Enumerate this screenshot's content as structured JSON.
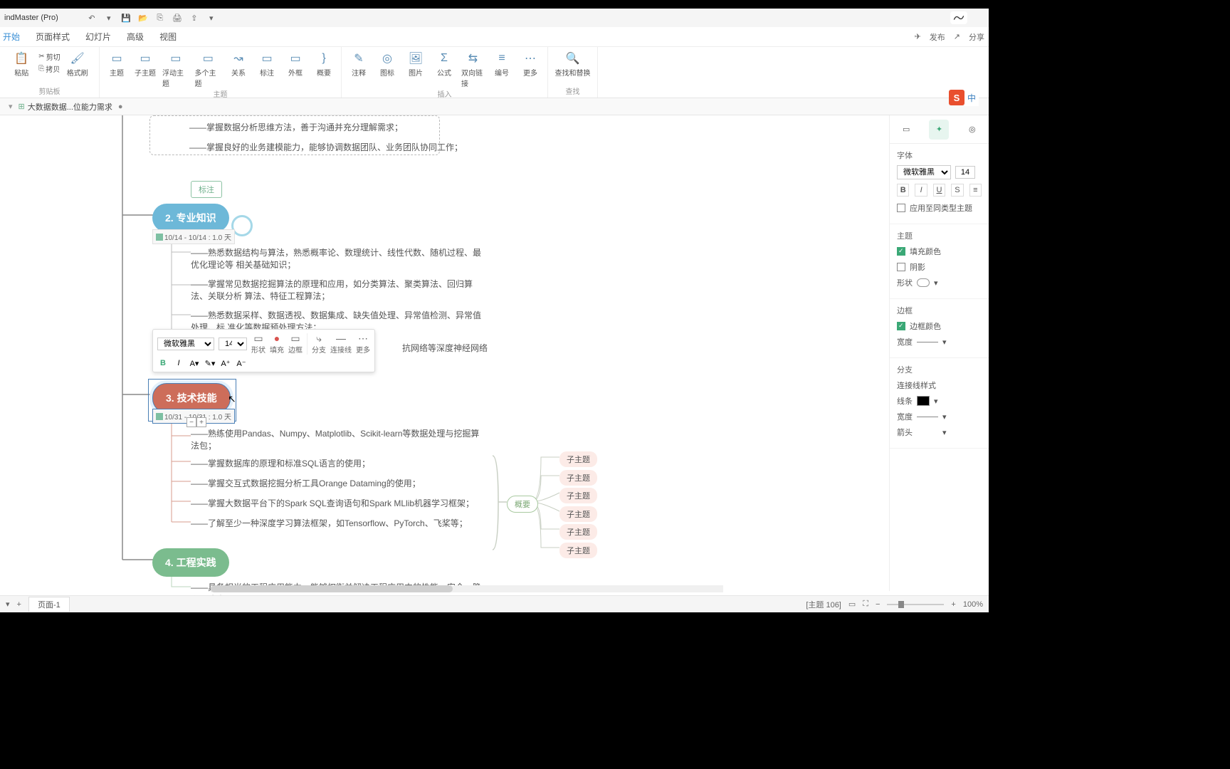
{
  "app": {
    "title": "indMaster (Pro)"
  },
  "menu": {
    "items": [
      "开始",
      "页面样式",
      "幻灯片",
      "高级",
      "视图"
    ],
    "publish": "发布",
    "share": "分享"
  },
  "ribbon": {
    "clipboard": {
      "paste": "粘贴",
      "cut": "剪切",
      "copy": "拷贝",
      "format_painter": "格式刷",
      "group": "剪贴板"
    },
    "topics": {
      "topic": "主题",
      "subtopic": "子主题",
      "floating": "浮动主题",
      "multiple": "多个主题",
      "relation": "关系",
      "callout": "标注",
      "boundary": "外框",
      "summary": "概要",
      "group": "主题"
    },
    "insert": {
      "note": "注释",
      "marker": "图标",
      "image": "图片",
      "formula": "公式",
      "hyperlink": "双向链接",
      "number": "编号",
      "more": "更多",
      "group": "插入"
    },
    "find": {
      "find_replace": "查找和替换",
      "group": "查找"
    }
  },
  "doc_tab": {
    "name": "大数据数据...位能力需求",
    "dirty": "●"
  },
  "canvas": {
    "dashed_notes": [
      "——掌握数据分析思维方法，善于沟通并充分理解需求；",
      "——掌握良好的业务建模能力，能够协调数据团队、业务团队协同工作；"
    ],
    "tag_label": "标注",
    "topic2": {
      "num": "2.",
      "text": "专业知识",
      "date": "10/14 - 10/14 : 1.0 天"
    },
    "topic2_children": [
      "——熟悉数据结构与算法，熟悉概率论、数理统计、线性代数、随机过程、最优化理论等 相关基础知识；",
      "——掌握常见数据挖掘算法的原理和应用，如分类算法、聚类算法、回归算法、关联分析 算法、特征工程算法；",
      "——熟悉数据采样、数据透视、数据集成、缺失值处理、异常值检测、异常值处理、标 准化等数据预处理方法；",
      "抗网络等深度神经网络"
    ],
    "topic3": {
      "num": "3.",
      "text": "技术技能",
      "date": "10/31 - 10/31 : 1.0 天"
    },
    "topic3_children": [
      "——熟练使用Pandas、Numpy、Matplotlib、Scikit-learn等数据处理与挖掘算法包；",
      "——掌握数据库的原理和标准SQL语言的使用；",
      "——掌握交互式数据挖掘分析工具Orange Dataming的使用；",
      "——掌握大数据平台下的Spark SQL查询语句和Spark MLlib机器学习框架；",
      "——了解至少一种深度学习算法框架，如Tensorflow、PyTorch、飞桨等；"
    ],
    "topic4": {
      "num": "4.",
      "text": "工程实践"
    },
    "topic4_children": [
      "——具备相当的工程应用能力，能够权衡并解决工程应用中的性能、安全、隐私、成本"
    ],
    "summary_label": "概要",
    "sub_placeholder": "子主题"
  },
  "float_tb": {
    "font": "微软雅黑",
    "size": "14",
    "shape": "形状",
    "fill": "填充",
    "border": "边框",
    "branch": "分支",
    "connector": "连接线",
    "more": "更多"
  },
  "rail": {
    "font_h": "字体",
    "font_name": "微软雅黑",
    "font_size": "14",
    "apply_all": "应用至同类型主题",
    "theme_h": "主题",
    "fill_color": "填充颜色",
    "shadow": "阴影",
    "shape": "形状",
    "border_h": "边框",
    "border_color": "边框颜色",
    "width": "宽度",
    "branch_h": "分支",
    "connector_style": "连接线样式",
    "line": "线条",
    "arrow": "箭头"
  },
  "status": {
    "page": "页面-1",
    "topic_count": "[主题 106]",
    "zoom": "100%"
  },
  "ime": {
    "s": "S",
    "cn": "中"
  }
}
